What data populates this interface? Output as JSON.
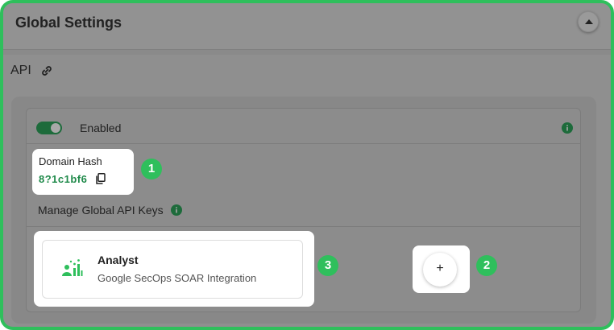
{
  "header": {
    "title": "Global Settings"
  },
  "api": {
    "label": "API"
  },
  "toggle": {
    "label": "Enabled",
    "state": "on",
    "color": "#1d6b3b"
  },
  "domain_hash": {
    "label": "Domain Hash",
    "value": "8?1c1bf6"
  },
  "manage": {
    "label": "Manage Global API Keys"
  },
  "analyst": {
    "name": "Analyst",
    "description": "Google SecOps SOAR Integration"
  },
  "add_button": {
    "label": "+"
  },
  "badges": {
    "b1": "1",
    "b2": "2",
    "b3": "3"
  },
  "colors": {
    "accent": "#2fbf5c",
    "hash_text": "#1f8a4a"
  },
  "icons": [
    "chevron-up-icon",
    "link-icon",
    "info-icon",
    "copy-icon",
    "analyst-icon"
  ]
}
